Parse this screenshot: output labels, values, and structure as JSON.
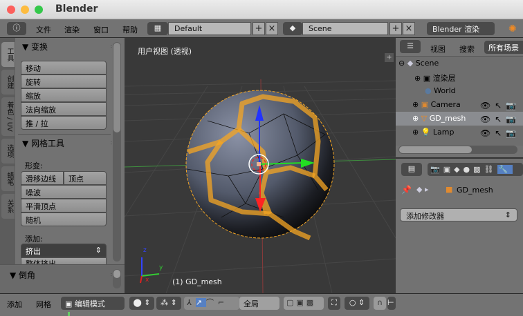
{
  "window": {
    "title": "Blender"
  },
  "topbar": {
    "menus": [
      "文件",
      "渲染",
      "窗口",
      "帮助"
    ],
    "layout": "Default",
    "scene": "Scene",
    "engine": "Blender 渲染"
  },
  "left_tabs": [
    "工具",
    "创建",
    "着色 / UV",
    "选项",
    "蜡笔",
    "关系"
  ],
  "toolshelf": {
    "transform": {
      "title": "变换",
      "buttons": [
        "移动",
        "旋转",
        "缩放",
        "法向缩放",
        "推 / 拉"
      ]
    },
    "mesh_tools": {
      "title": "网格工具",
      "deform_label": "形变:",
      "deform_buttons": [
        "滑移边线",
        "顶点",
        "噪波",
        "平滑顶点",
        "随机"
      ],
      "add_label": "添加:",
      "extrude": "挤出",
      "extrude_region": "整体挤出"
    },
    "bevel": {
      "title": "倒角"
    }
  },
  "viewport": {
    "view_label": "用户视图 (透视)",
    "object_label": "(1) GD_mesh",
    "axes": {
      "x": "x",
      "y": "y",
      "z": "z"
    }
  },
  "outliner": {
    "menus": [
      "视图",
      "搜索"
    ],
    "filter": "所有场景",
    "items": [
      "Scene",
      "渲染层",
      "World",
      "Camera",
      "GD_mesh",
      "Lamp"
    ],
    "selected": "GD_mesh"
  },
  "properties": {
    "object": "GD_mesh",
    "add_modifier": "添加修改器",
    "active_tab": "modifiers"
  },
  "bottombar": {
    "menus": [
      "添加",
      "网格"
    ],
    "mode": "编辑模式",
    "orientation": "全局"
  },
  "colors": {
    "accent": "#5680c2",
    "selection": "#f5a623",
    "bg": "#393939"
  }
}
